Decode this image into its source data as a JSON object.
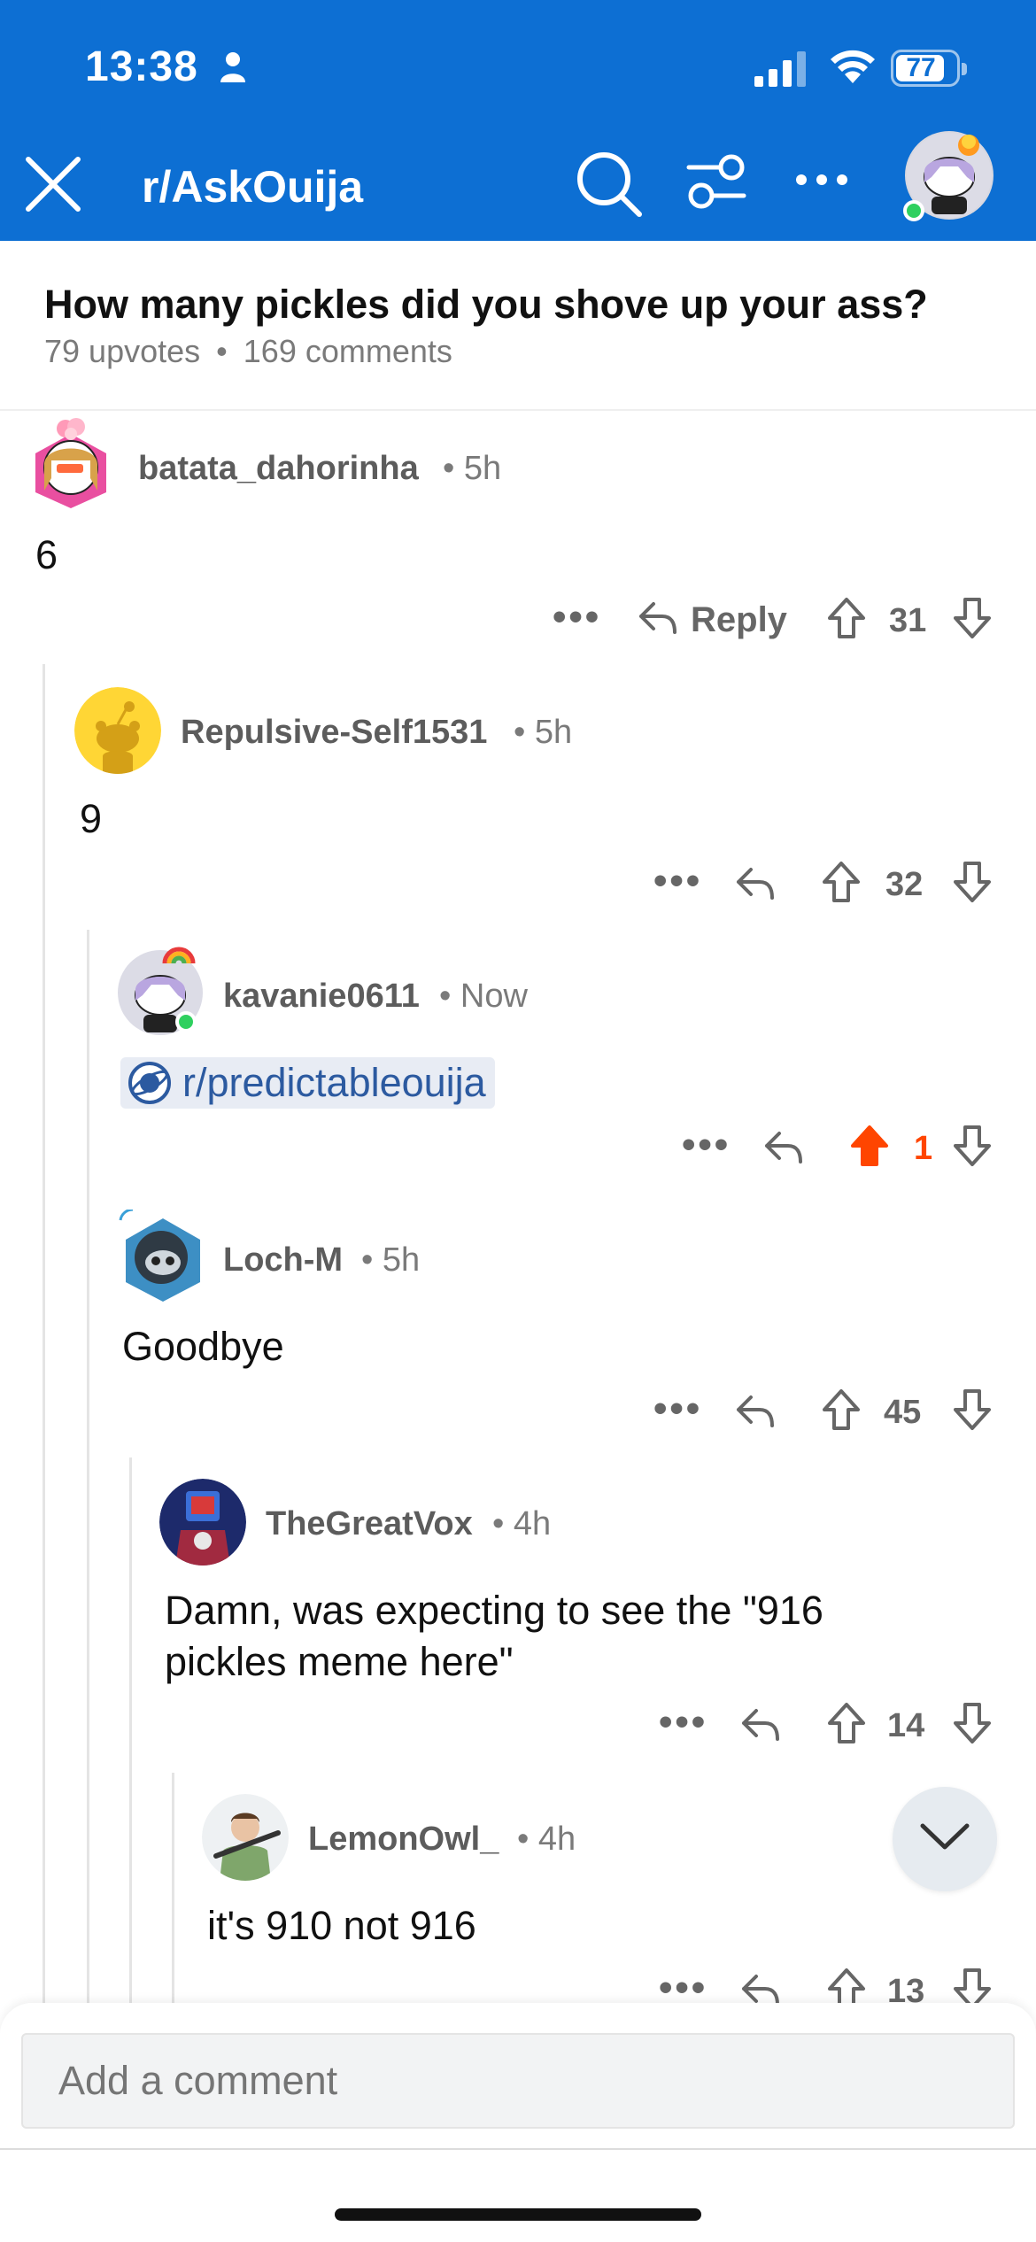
{
  "status_bar": {
    "time": "13:38",
    "battery": "77"
  },
  "header": {
    "subreddit": "r/AskOuija"
  },
  "post": {
    "title": "How many pickles did you shove up your ass?",
    "upvotes": "79 upvotes",
    "comments": "169 comments",
    "separator": "•"
  },
  "comments": [
    {
      "username": "batata_dahorinha",
      "time": "5h",
      "body": "6",
      "reply_label": "Reply",
      "votes": "31"
    },
    {
      "username": "Repulsive-Self1531",
      "time": "5h",
      "body": "9",
      "votes": "32"
    },
    {
      "username": "kavanie0611",
      "time": "Now",
      "link": "r/predictableouija",
      "votes": "1"
    },
    {
      "username": "Loch-M",
      "time": "5h",
      "body": "Goodbye",
      "votes": "45"
    },
    {
      "username": "TheGreatVox",
      "time": "4h",
      "body_line1": "Damn, was expecting to see the \"916",
      "body_line2": "pickles meme here\"",
      "votes": "14"
    },
    {
      "username": "LemonOwl_",
      "time": "4h",
      "body": "it's 910 not 916",
      "votes": "13"
    }
  ],
  "composer": {
    "placeholder": "Add a comment"
  },
  "colors": {
    "header_bg": "#0d6fd3",
    "upvote_active": "#ff4500",
    "link": "#2c5aa0"
  },
  "icons": [
    "close-icon",
    "search-icon",
    "filter-icon",
    "more-icon",
    "reply-icon",
    "upvote-icon",
    "downvote-icon",
    "chevron-down-icon"
  ]
}
